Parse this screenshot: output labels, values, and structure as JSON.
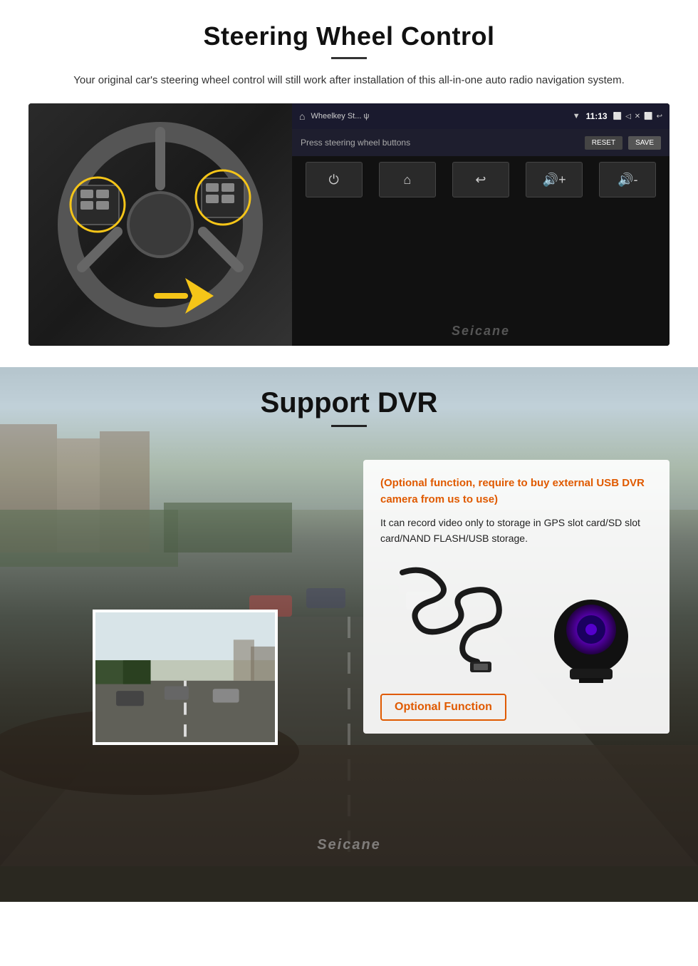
{
  "swc": {
    "title": "Steering Wheel Control",
    "subtitle": "Your original car's steering wheel control will still work after installation of this all-in-one auto radio navigation system.",
    "screen": {
      "statusbar_title": "Wheelkey St... ψ",
      "time": "11:13",
      "toolbar_label": "Press steering wheel buttons",
      "reset_btn": "RESET",
      "save_btn": "SAVE",
      "buttons": [
        "⏻",
        "⌂",
        "↩",
        "🔊+",
        "🔊-"
      ],
      "watermark": "Seicane"
    }
  },
  "dvr": {
    "title": "Support DVR",
    "optional_text": "(Optional function, require to buy external USB DVR camera from us to use)",
    "description": "It can record video only to storage in GPS slot card/SD slot card/NAND FLASH/USB storage.",
    "optional_badge": "Optional Function",
    "watermark": "Seicane"
  }
}
